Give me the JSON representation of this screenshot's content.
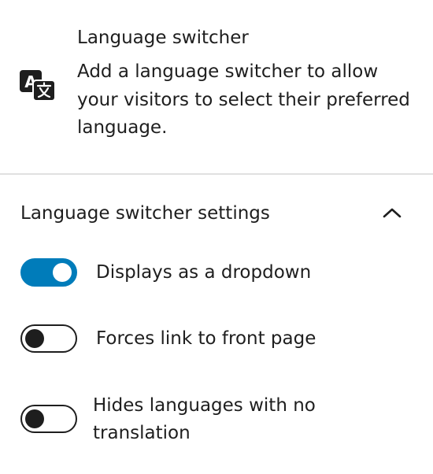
{
  "block": {
    "icon": "translation-icon",
    "title": "Language switcher",
    "description": "Add a language switcher to allow your visitors to select their preferred language."
  },
  "panel": {
    "title": "Language switcher settings",
    "expanded": true,
    "toggle_icon": "chevron-up-icon",
    "toggles": [
      {
        "label": "Displays as a dropdown",
        "checked": true
      },
      {
        "label": "Forces link to front page",
        "checked": false
      },
      {
        "label": "Hides languages with no",
        "label_line2": "translation",
        "checked": false
      }
    ]
  },
  "colors": {
    "accent": "#007cba",
    "text": "#1e1e1e",
    "divider": "#e0e0e0",
    "background": "#ffffff"
  }
}
